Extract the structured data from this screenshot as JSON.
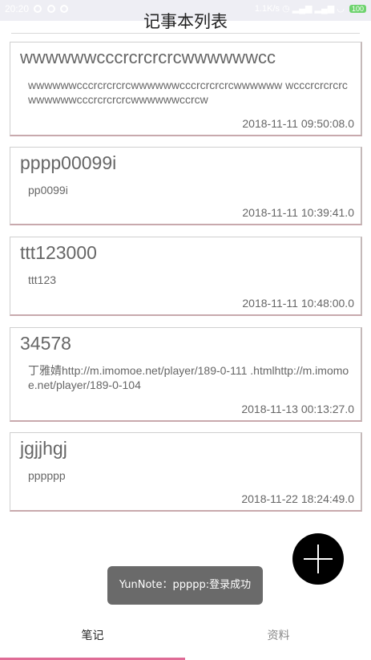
{
  "status_bar": {
    "time": "20:20",
    "net_speed": "1.1K/s",
    "battery": "100"
  },
  "header": {
    "title": "记事本列表"
  },
  "notes": [
    {
      "title": "wwwwwwcccrcrcrcrcwwwwwwcc",
      "content": "wwwwwwcccrcrcrcrcwwwwwwcccrcrcrcrcwwwwww wcccrcrcrcrcwwwwwwcccrcrcrcrcwwwwwwccrcw",
      "time": "2018-11-11 09:50:08.0"
    },
    {
      "title": "pppp00099i",
      "content": "pp0099i",
      "time": "2018-11-11 10:39:41.0"
    },
    {
      "title": "ttt123000",
      "content": "ttt123",
      "time": "2018-11-11 10:48:00.0"
    },
    {
      "title": "34578",
      "content": "丁雅婧http://m.imomoe.net/player/189-0-111 .htmlhttp://m.imomoe.net/player/189-0-104",
      "time": "2018-11-13 00:13:27.0"
    },
    {
      "title": "jgjjhgj",
      "content": "pppppp",
      "time": "2018-11-22 18:24:49.0"
    }
  ],
  "fab": {
    "icon": "plus-icon"
  },
  "toast": {
    "text": "YunNote：ppppp:登录成功"
  },
  "bottom_nav": {
    "tabs": [
      {
        "label": "笔记",
        "active": true
      },
      {
        "label": "资料",
        "active": false
      }
    ],
    "accent_color": "#e06c97"
  }
}
